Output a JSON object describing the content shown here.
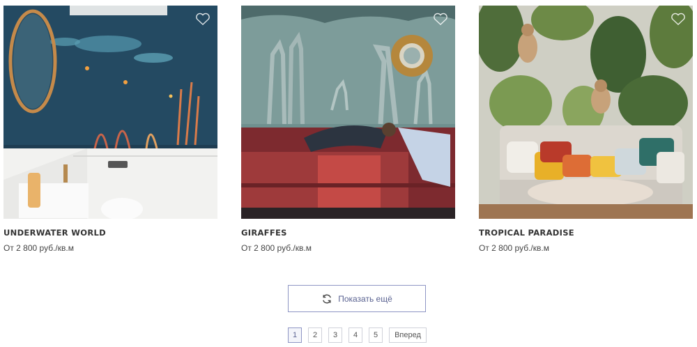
{
  "products": [
    {
      "name": "UNDERWATER WORLD",
      "price": "От 2 800 руб./кв.м",
      "image": "underwater-bathroom-mural"
    },
    {
      "name": "GIRAFFES",
      "price": "От 2 800 руб./кв.м",
      "image": "giraffes-bedroom-mural"
    },
    {
      "name": "TROPICAL PARADISE",
      "price": "От 2 800 руб./кв.м",
      "image": "tropical-monkeys-living-room-mural"
    }
  ],
  "load_more": {
    "label": "Показать ещё",
    "icon": "refresh-icon"
  },
  "pagination": {
    "pages": [
      "1",
      "2",
      "3",
      "4",
      "5"
    ],
    "current": "1",
    "next_label": "Вперед"
  },
  "favorite_icon": "heart-outline-icon",
  "colors": {
    "accent": "#8e95c4",
    "accent_text": "#5a6291",
    "text": "#333333"
  }
}
